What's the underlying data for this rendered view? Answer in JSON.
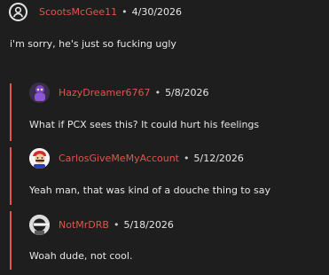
{
  "thread": {
    "parent": {
      "username": "ScootsMcGee11",
      "date": "4/30/2026",
      "text": "i'm sorry, he's just so fucking ugly"
    },
    "replies": [
      {
        "username": "HazyDreamer6767",
        "date": "5/8/2026",
        "text": "What if PCX sees this? It could hurt his feelings"
      },
      {
        "username": "CarlosGiveMeMyAccount",
        "date": "5/12/2026",
        "text": "Yeah man, that was kind of a douche thing to say"
      },
      {
        "username": "NotMrDRB",
        "date": "5/18/2026",
        "text": "Woah dude, not cool."
      }
    ],
    "separator": "•"
  },
  "colors": {
    "background": "#1e1e1e",
    "username": "#e0554f",
    "text": "#e6e6e6",
    "reply_bar": "#e0554f"
  },
  "icons": {
    "parent_avatar": "user-circle-icon",
    "reply_1_avatar": "purple-character-avatar",
    "reply_2_avatar": "mario-character-avatar",
    "reply_3_avatar": "ninja-character-avatar"
  }
}
